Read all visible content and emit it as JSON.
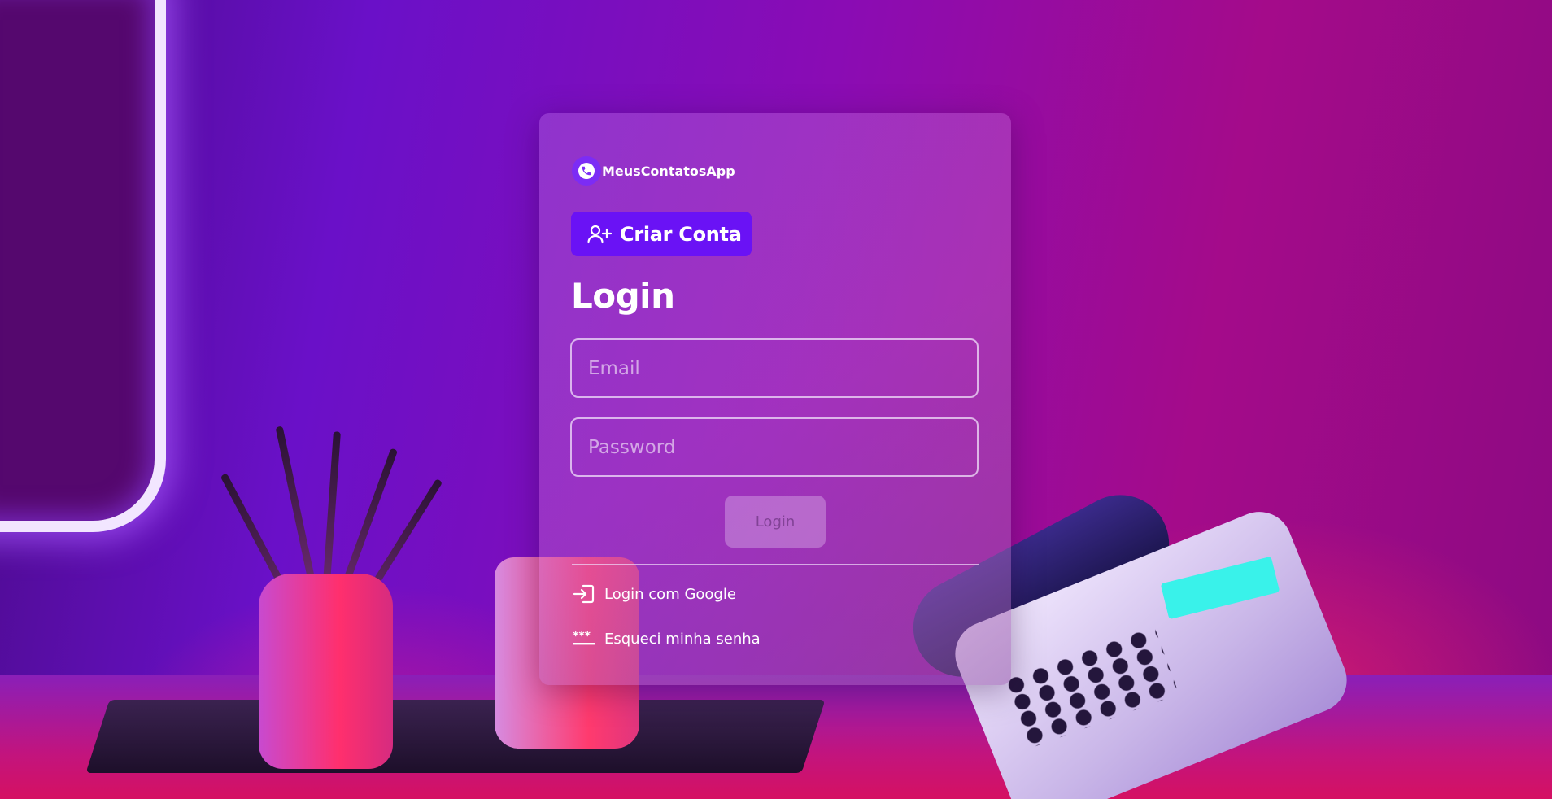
{
  "app": {
    "brand_name": "MeusContatosApp",
    "brand_icon": "phone-icon"
  },
  "actions": {
    "create_account_label": "Criar Conta",
    "create_account_icon": "add-user-icon"
  },
  "form": {
    "title": "Login",
    "email_placeholder": "Email",
    "email_value": "",
    "password_placeholder": "Password",
    "password_value": "",
    "submit_label": "Login",
    "submit_disabled": true
  },
  "links": {
    "google_label": "Login com Google",
    "google_icon": "login-icon",
    "forgot_label": "Esqueci minha senha",
    "forgot_icon": "password-icon"
  },
  "colors": {
    "primary": "#6a12f5",
    "text": "#ffffff"
  }
}
